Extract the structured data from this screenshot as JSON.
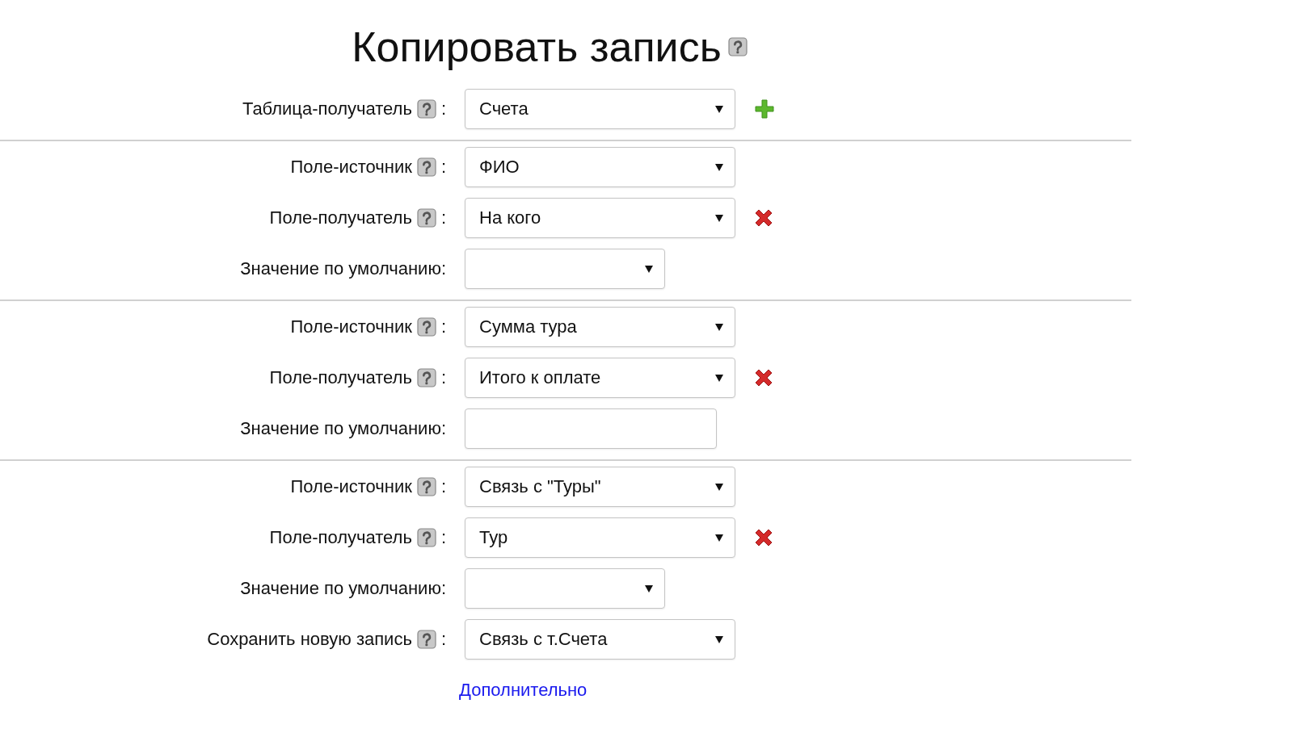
{
  "title": "Копировать запись",
  "title_help": true,
  "groups": [
    {
      "rows": [
        {
          "label": "Таблица-получатель",
          "help": true,
          "colon": ":",
          "kind": "select",
          "value": "Счета",
          "add": true,
          "delete": false
        }
      ]
    },
    {
      "rows": [
        {
          "label": "Поле-источник",
          "help": true,
          "colon": ":",
          "kind": "select",
          "value": "ФИО",
          "add": false,
          "delete": false
        },
        {
          "label": "Поле-получатель",
          "help": true,
          "colon": ":",
          "kind": "select",
          "value": "На кого",
          "add": false,
          "delete": true
        },
        {
          "label": "Значение по умолчанию:",
          "help": false,
          "kind": "select-short",
          "value": "",
          "add": false,
          "delete": false
        }
      ]
    },
    {
      "rows": [
        {
          "label": "Поле-источник",
          "help": true,
          "colon": ":",
          "kind": "select",
          "value": "Сумма тура",
          "add": false,
          "delete": false
        },
        {
          "label": "Поле-получатель",
          "help": true,
          "colon": ":",
          "kind": "select",
          "value": "Итого к оплате",
          "add": false,
          "delete": true
        },
        {
          "label": "Значение по умолчанию:",
          "help": false,
          "kind": "text",
          "value": "",
          "add": false,
          "delete": false
        }
      ]
    },
    {
      "rows": [
        {
          "label": "Поле-источник",
          "help": true,
          "colon": ":",
          "kind": "select",
          "value": "Связь с \"Туры\"",
          "add": false,
          "delete": false
        },
        {
          "label": "Поле-получатель",
          "help": true,
          "colon": ":",
          "kind": "select",
          "value": "Тур",
          "add": false,
          "delete": true
        },
        {
          "label": "Значение по умолчанию:",
          "help": false,
          "kind": "select-short",
          "value": "",
          "add": false,
          "delete": false
        },
        {
          "label": "Сохранить новую запись",
          "help": true,
          "colon": ":",
          "kind": "select",
          "value": "Связь с т.Счета",
          "add": false,
          "delete": false
        }
      ]
    }
  ],
  "link": "Дополнительно"
}
